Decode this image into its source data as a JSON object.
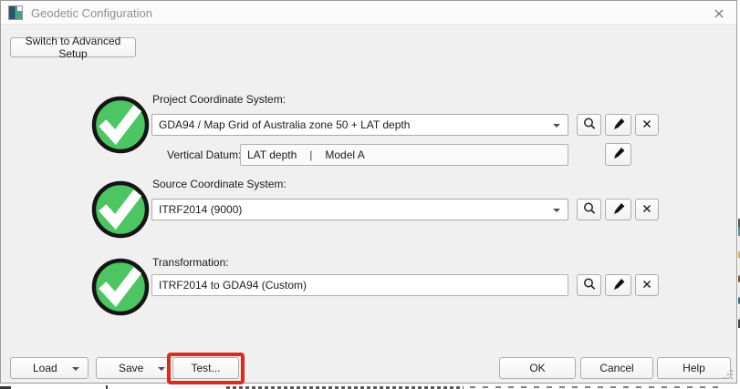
{
  "window": {
    "title": "Geodetic Configuration"
  },
  "setup": {
    "switch_button": "Switch to Advanced Setup"
  },
  "project": {
    "label": "Project Coordinate System:",
    "selected": "GDA94 / Map Grid of Australia zone 50 + LAT depth",
    "status": "valid",
    "vertical_datum": {
      "label": "Vertical Datum:",
      "primary": "LAT depth",
      "separator": "|",
      "secondary": "Model A"
    }
  },
  "source": {
    "label": "Source Coordinate System:",
    "selected": "ITRF2014 (9000)",
    "status": "valid"
  },
  "transformation": {
    "label": "Transformation:",
    "value": "ITRF2014 to GDA94 (Custom)",
    "status": "valid"
  },
  "footer": {
    "load": "Load",
    "save": "Save",
    "test": "Test...",
    "ok": "OK",
    "cancel": "Cancel",
    "help": "Help"
  },
  "icons": {
    "status": "green-checkmark-circle",
    "browse": "magnifier",
    "edit": "pen",
    "clear": "x",
    "dropdown": "chevron-down",
    "close": "x"
  },
  "annotation": {
    "target": "test-button",
    "color": "#de2b1e"
  },
  "colors": {
    "status_green": "#4cc562",
    "dialog_bg": "#f0f0f0",
    "titlebar_bg": "#fbfbfb",
    "annotation_red": "#de2b1e"
  }
}
